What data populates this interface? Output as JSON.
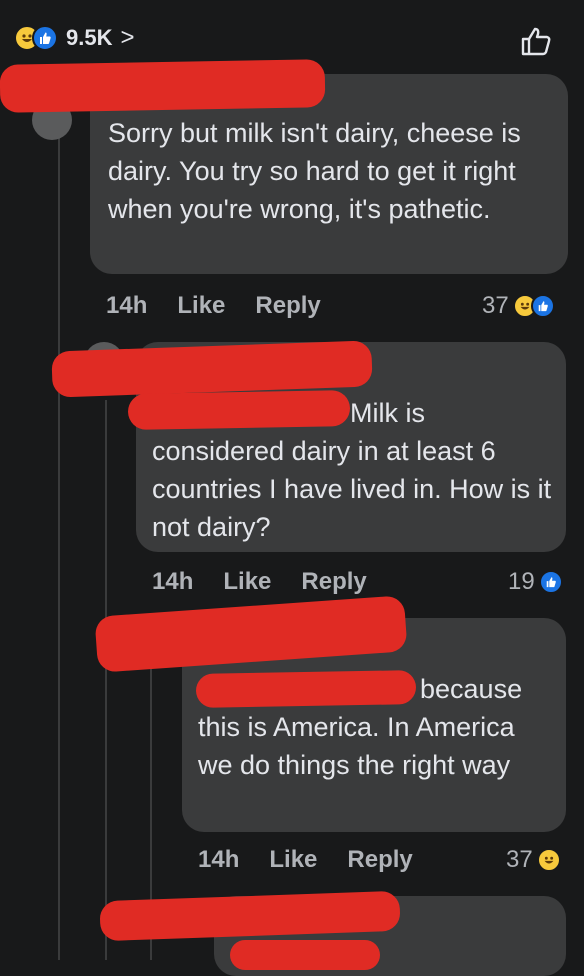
{
  "header": {
    "reaction_count": "9.5K",
    "chevron": ">",
    "reaction_icons": [
      "haha-icon",
      "like-icon"
    ],
    "like_button_icon": "thumbs-up-outline-icon"
  },
  "comments": [
    {
      "text": "Sorry but milk isn't dairy, cheese is dairy. You try so hard to get it right when you're wrong, it's pathetic.",
      "time": "14h",
      "like_label": "Like",
      "reply_label": "Reply",
      "reaction_count": "37",
      "reactions": [
        "haha-icon",
        "like-icon"
      ]
    },
    {
      "text": "Milk is considered dairy in at least 6 countries I have lived in. How is it not dairy?",
      "time": "14h",
      "like_label": "Like",
      "reply_label": "Reply",
      "reaction_count": "19",
      "reactions": [
        "like-icon"
      ]
    },
    {
      "text": "because this is America. In America we do things the right way",
      "time": "14h",
      "like_label": "Like",
      "reply_label": "Reply",
      "reaction_count": "37",
      "reactions": [
        "haha-icon"
      ]
    }
  ],
  "colors": {
    "background": "#18191a",
    "bubble": "#3a3b3c",
    "text": "#e4e6eb",
    "muted": "#b0b3b8",
    "redaction": "#e02b24",
    "like_blue": "#1b74e4",
    "haha_yellow": "#f7c93c"
  }
}
